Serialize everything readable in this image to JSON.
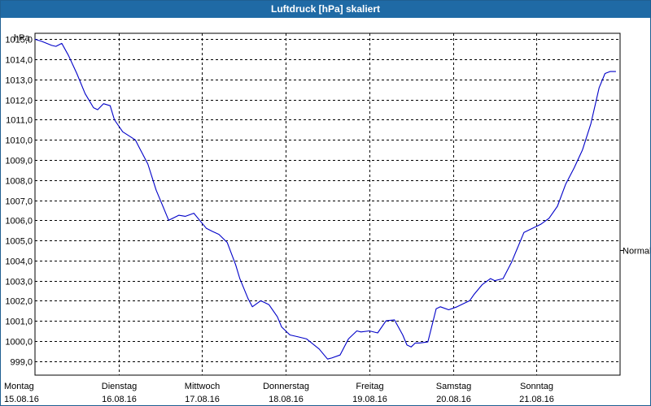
{
  "window": {
    "title": "Luftdruck [hPa] skaliert"
  },
  "colors": {
    "titlebar": "#1f6aa5",
    "series": "#0000c8",
    "grid": "#000000"
  },
  "chart_data": {
    "type": "line",
    "title": "Luftdruck [hPa] skaliert",
    "ylabel": "hPa",
    "xlabel": "",
    "ylim": [
      998.3,
      1015.3
    ],
    "yticks": [
      999,
      1000,
      1001,
      1002,
      1003,
      1004,
      1005,
      1006,
      1007,
      1008,
      1009,
      1010,
      1011,
      1012,
      1013,
      1014,
      1015
    ],
    "ytick_labels": [
      "999,0",
      "1000,0",
      "1001,0",
      "1002,0",
      "1003,0",
      "1004,0",
      "1005,0",
      "1006,0",
      "1007,0",
      "1008,0",
      "1009,0",
      "1010,0",
      "1011,0",
      "1012,0",
      "1013,0",
      "1014,0",
      "1015,0"
    ],
    "x_day_range": [
      0,
      7
    ],
    "x_categories": [
      {
        "day": "Montag",
        "date": "15.08.16"
      },
      {
        "day": "Dienstag",
        "date": "16.08.16"
      },
      {
        "day": "Mittwoch",
        "date": "17.08.16"
      },
      {
        "day": "Donnerstag",
        "date": "18.08.16"
      },
      {
        "day": "Freitag",
        "date": "19.08.16"
      },
      {
        "day": "Samstag",
        "date": "20.08.16"
      },
      {
        "day": "Sonntag",
        "date": "21.08.16"
      }
    ],
    "reference_line": {
      "label": "Normal",
      "value": 1004.5
    },
    "grid": true,
    "series": [
      {
        "x": [
          0.0,
          0.08,
          0.2,
          0.25,
          0.32,
          0.4,
          0.5,
          0.6,
          0.7,
          0.75,
          0.82,
          0.9,
          0.95,
          1.05,
          1.2,
          1.25,
          1.35,
          1.45,
          1.55,
          1.6,
          1.72,
          1.8,
          1.9,
          1.95,
          2.05,
          2.12,
          2.2,
          2.3,
          2.4,
          2.45,
          2.55,
          2.6,
          2.7,
          2.75,
          2.8,
          2.9,
          2.95,
          3.05,
          3.15,
          3.25,
          3.4,
          3.5,
          3.55,
          3.65,
          3.75,
          3.85,
          3.9,
          4.0,
          4.1,
          4.2,
          4.3,
          4.4,
          4.45,
          4.5,
          4.55,
          4.6,
          4.7,
          4.8,
          4.85,
          4.95,
          5.05,
          5.15,
          5.2,
          5.25,
          5.35,
          5.45,
          5.5,
          5.6,
          5.7,
          5.85,
          6.0,
          6.05,
          6.15,
          6.25,
          6.35,
          6.45,
          6.55,
          6.65,
          6.75,
          6.82,
          6.88,
          6.92,
          6.95
        ],
        "y": [
          1015.0,
          1014.9,
          1014.7,
          1014.65,
          1014.8,
          1014.2,
          1013.3,
          1012.3,
          1011.6,
          1011.5,
          1011.8,
          1011.7,
          1011.0,
          1010.4,
          1010.0,
          1009.6,
          1008.8,
          1007.5,
          1006.5,
          1006.0,
          1006.25,
          1006.2,
          1006.35,
          1006.1,
          1005.6,
          1005.45,
          1005.3,
          1004.9,
          1003.8,
          1003.1,
          1002.1,
          1001.7,
          1002.0,
          1001.9,
          1001.8,
          1001.2,
          1000.7,
          1000.3,
          1000.2,
          1000.1,
          999.6,
          999.1,
          999.15,
          999.3,
          1000.1,
          1000.5,
          1000.45,
          1000.5,
          1000.4,
          1001.0,
          1001.05,
          1000.3,
          999.8,
          999.7,
          999.9,
          999.9,
          999.95,
          1001.6,
          1001.7,
          1001.55,
          1001.7,
          1001.9,
          1002.0,
          1002.3,
          1002.8,
          1003.1,
          1003.0,
          1003.1,
          1003.9,
          1005.4,
          1005.7,
          1005.8,
          1006.1,
          1006.7,
          1007.8,
          1008.6,
          1009.5,
          1010.8,
          1012.6,
          1013.3,
          1013.4,
          1013.4,
          1013.4
        ]
      }
    ]
  }
}
